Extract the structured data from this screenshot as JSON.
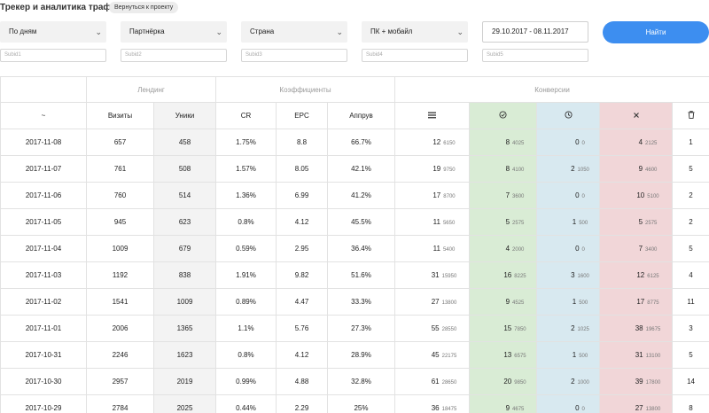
{
  "header": {
    "title": "Трекер и аналитика трафика",
    "back_label": "Вернуться к проекту"
  },
  "filters": {
    "group_by": "По дням",
    "partner": "Партнёрка",
    "country": "Страна",
    "device": "ПК + мобайл",
    "date_range": "29.10.2017 - 08.11.2017",
    "find_label": "Найти",
    "subid1": "Subid1",
    "subid2": "Subid2",
    "subid3": "Subid3",
    "subid4": "Subid4",
    "subid5": "Subid5"
  },
  "table": {
    "groups": {
      "landing": "Лендинг",
      "coefficients": "Коэффициенты",
      "conversions": "Конверсии"
    },
    "columns": {
      "date": "~",
      "visits": "Визиты",
      "uniques": "Уники",
      "cr": "CR",
      "epc": "EPC",
      "approve": "Аппрув",
      "total_icon": "list-icon",
      "approved_icon": "check-circle-icon",
      "pending_icon": "clock-icon",
      "rejected_icon": "close-icon",
      "trash_icon": "trash-icon"
    },
    "colors": {
      "approved_bg": "#d9ecd5",
      "pending_bg": "#d8e9f0",
      "rejected_bg": "#f1d6d8",
      "accent": "#3d8ef0"
    },
    "rows": [
      {
        "date": "2017-11-08",
        "visits": "657",
        "uniques": "458",
        "cr": "1.75%",
        "epc": "8.8",
        "approve": "66.7%",
        "total": "12",
        "total_sum": "6150",
        "approved": "8",
        "approved_sum": "4025",
        "pending": "0",
        "pending_sum": "0",
        "rejected": "4",
        "rejected_sum": "2125",
        "trash": "1"
      },
      {
        "date": "2017-11-07",
        "visits": "761",
        "uniques": "508",
        "cr": "1.57%",
        "epc": "8.05",
        "approve": "42.1%",
        "total": "19",
        "total_sum": "9750",
        "approved": "8",
        "approved_sum": "4100",
        "pending": "2",
        "pending_sum": "1050",
        "rejected": "9",
        "rejected_sum": "4600",
        "trash": "5"
      },
      {
        "date": "2017-11-06",
        "visits": "760",
        "uniques": "514",
        "cr": "1.36%",
        "epc": "6.99",
        "approve": "41.2%",
        "total": "17",
        "total_sum": "8700",
        "approved": "7",
        "approved_sum": "3600",
        "pending": "0",
        "pending_sum": "0",
        "rejected": "10",
        "rejected_sum": "5100",
        "trash": "2"
      },
      {
        "date": "2017-11-05",
        "visits": "945",
        "uniques": "623",
        "cr": "0.8%",
        "epc": "4.12",
        "approve": "45.5%",
        "total": "11",
        "total_sum": "5650",
        "approved": "5",
        "approved_sum": "2575",
        "pending": "1",
        "pending_sum": "500",
        "rejected": "5",
        "rejected_sum": "2575",
        "trash": "2"
      },
      {
        "date": "2017-11-04",
        "visits": "1009",
        "uniques": "679",
        "cr": "0.59%",
        "epc": "2.95",
        "approve": "36.4%",
        "total": "11",
        "total_sum": "5400",
        "approved": "4",
        "approved_sum": "2000",
        "pending": "0",
        "pending_sum": "0",
        "rejected": "7",
        "rejected_sum": "3400",
        "trash": "5"
      },
      {
        "date": "2017-11-03",
        "visits": "1192",
        "uniques": "838",
        "cr": "1.91%",
        "epc": "9.82",
        "approve": "51.6%",
        "total": "31",
        "total_sum": "15950",
        "approved": "16",
        "approved_sum": "8225",
        "pending": "3",
        "pending_sum": "1600",
        "rejected": "12",
        "rejected_sum": "6125",
        "trash": "4"
      },
      {
        "date": "2017-11-02",
        "visits": "1541",
        "uniques": "1009",
        "cr": "0.89%",
        "epc": "4.47",
        "approve": "33.3%",
        "total": "27",
        "total_sum": "13800",
        "approved": "9",
        "approved_sum": "4525",
        "pending": "1",
        "pending_sum": "500",
        "rejected": "17",
        "rejected_sum": "8775",
        "trash": "11"
      },
      {
        "date": "2017-11-01",
        "visits": "2006",
        "uniques": "1365",
        "cr": "1.1%",
        "epc": "5.76",
        "approve": "27.3%",
        "total": "55",
        "total_sum": "28550",
        "approved": "15",
        "approved_sum": "7850",
        "pending": "2",
        "pending_sum": "1025",
        "rejected": "38",
        "rejected_sum": "19675",
        "trash": "3"
      },
      {
        "date": "2017-10-31",
        "visits": "2246",
        "uniques": "1623",
        "cr": "0.8%",
        "epc": "4.12",
        "approve": "28.9%",
        "total": "45",
        "total_sum": "22175",
        "approved": "13",
        "approved_sum": "6575",
        "pending": "1",
        "pending_sum": "500",
        "rejected": "31",
        "rejected_sum": "13100",
        "trash": "5"
      },
      {
        "date": "2017-10-30",
        "visits": "2957",
        "uniques": "2019",
        "cr": "0.99%",
        "epc": "4.88",
        "approve": "32.8%",
        "total": "61",
        "total_sum": "28650",
        "approved": "20",
        "approved_sum": "9850",
        "pending": "2",
        "pending_sum": "1000",
        "rejected": "39",
        "rejected_sum": "17800",
        "trash": "14"
      },
      {
        "date": "2017-10-29",
        "visits": "2784",
        "uniques": "2025",
        "cr": "0.44%",
        "epc": "2.29",
        "approve": "25%",
        "total": "36",
        "total_sum": "18475",
        "approved": "9",
        "approved_sum": "4675",
        "pending": "0",
        "pending_sum": "0",
        "rejected": "27",
        "rejected_sum": "13800",
        "trash": "8"
      }
    ]
  }
}
